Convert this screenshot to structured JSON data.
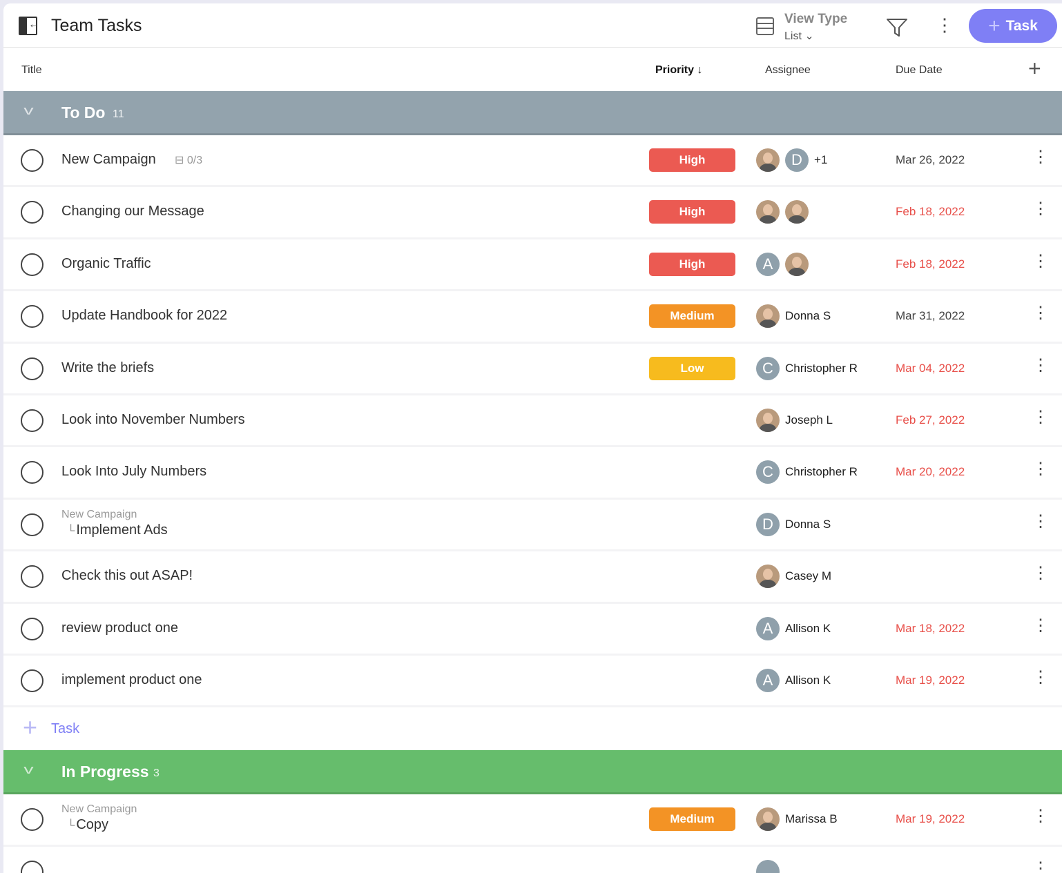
{
  "header": {
    "title": "Team Tasks",
    "view_type_label": "View Type",
    "view_type_value": "List",
    "add_task_label": "Task"
  },
  "columns": {
    "title": "Title",
    "priority": "Priority",
    "assignee": "Assignee",
    "due_date": "Due Date"
  },
  "colors": {
    "accent": "#7f7ff5",
    "high": "#eb5a52",
    "medium": "#f39325",
    "low": "#f7bb1e",
    "overdue": "#e8504a",
    "todo_group": "#93a3ad",
    "in_progress_group": "#66bd6c"
  },
  "groups": [
    {
      "name": "To Do",
      "count": "11",
      "color": "#93a3ad",
      "add_label": "Task",
      "tasks": [
        {
          "title": "New Campaign",
          "subtasks": "0/3",
          "priority": "High",
          "assignees": [
            {
              "type": "photo"
            },
            {
              "type": "letter",
              "letter": "D"
            }
          ],
          "extra": "+1",
          "due": "Mar 26, 2022",
          "overdue": false
        },
        {
          "title": "Changing our Message",
          "priority": "High",
          "assignees": [
            {
              "type": "photo"
            },
            {
              "type": "photo"
            }
          ],
          "due": "Feb 18, 2022",
          "overdue": true
        },
        {
          "title": "Organic Traffic",
          "priority": "High",
          "assignees": [
            {
              "type": "letter",
              "letter": "A"
            },
            {
              "type": "photo"
            }
          ],
          "due": "Feb 18, 2022",
          "overdue": true
        },
        {
          "title": "Update Handbook for 2022",
          "priority": "Medium",
          "assignees": [
            {
              "type": "photo"
            }
          ],
          "assignee_name": "Donna S",
          "due": "Mar 31, 2022",
          "overdue": false
        },
        {
          "title": "Write the briefs",
          "priority": "Low",
          "assignees": [
            {
              "type": "letter",
              "letter": "C"
            }
          ],
          "assignee_name": "Christopher R",
          "due": "Mar 04, 2022",
          "overdue": true
        },
        {
          "title": "Look into November Numbers",
          "assignees": [
            {
              "type": "photo"
            }
          ],
          "assignee_name": "Joseph L",
          "due": "Feb 27, 2022",
          "overdue": true
        },
        {
          "title": "Look Into July Numbers",
          "assignees": [
            {
              "type": "letter",
              "letter": "C"
            }
          ],
          "assignee_name": "Christopher R",
          "due": "Mar 20, 2022",
          "overdue": true
        },
        {
          "parent": "New Campaign",
          "title": "Implement Ads",
          "assignees": [
            {
              "type": "letter",
              "letter": "D"
            }
          ],
          "assignee_name": "Donna S"
        },
        {
          "title": "Check this out ASAP!",
          "assignees": [
            {
              "type": "photo"
            }
          ],
          "assignee_name": "Casey M"
        },
        {
          "title": "review product one",
          "assignees": [
            {
              "type": "letter",
              "letter": "A"
            }
          ],
          "assignee_name": "Allison K",
          "due": "Mar 18, 2022",
          "overdue": true
        },
        {
          "title": "implement product one",
          "assignees": [
            {
              "type": "letter",
              "letter": "A"
            }
          ],
          "assignee_name": "Allison K",
          "due": "Mar 19, 2022",
          "overdue": true
        }
      ]
    },
    {
      "name": "In Progress",
      "count": "3",
      "color": "#66bd6c",
      "tasks": [
        {
          "parent": "New Campaign",
          "title": "Copy",
          "priority": "Medium",
          "assignees": [
            {
              "type": "photo"
            }
          ],
          "assignee_name": "Marissa B",
          "due": "Mar 19, 2022",
          "overdue": true
        },
        {
          "title": "",
          "assignees": [
            {
              "type": "letter",
              "letter": ""
            }
          ]
        }
      ]
    }
  ]
}
